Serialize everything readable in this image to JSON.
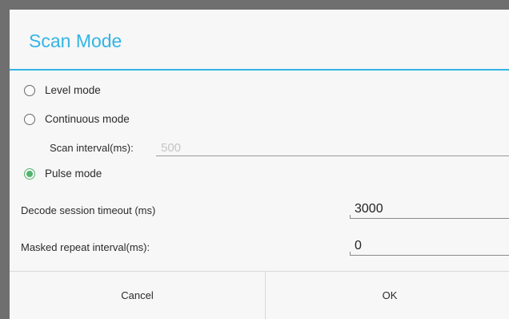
{
  "dialog": {
    "title": "Scan Mode",
    "accent_color": "#33b5e5",
    "radio_checked_color": "#52b36f"
  },
  "modes": {
    "level": {
      "label": "Level mode",
      "selected": false
    },
    "continuous": {
      "label": "Continuous mode",
      "selected": false
    },
    "pulse": {
      "label": "Pulse mode",
      "selected": true
    }
  },
  "scan_interval": {
    "label": "Scan interval(ms):",
    "value": "500",
    "disabled": true
  },
  "decode_timeout": {
    "label": "Decode session timeout (ms)",
    "value": "3000"
  },
  "masked_repeat": {
    "label": "Masked repeat interval(ms):",
    "value": "0"
  },
  "buttons": {
    "cancel": "Cancel",
    "ok": "OK"
  }
}
